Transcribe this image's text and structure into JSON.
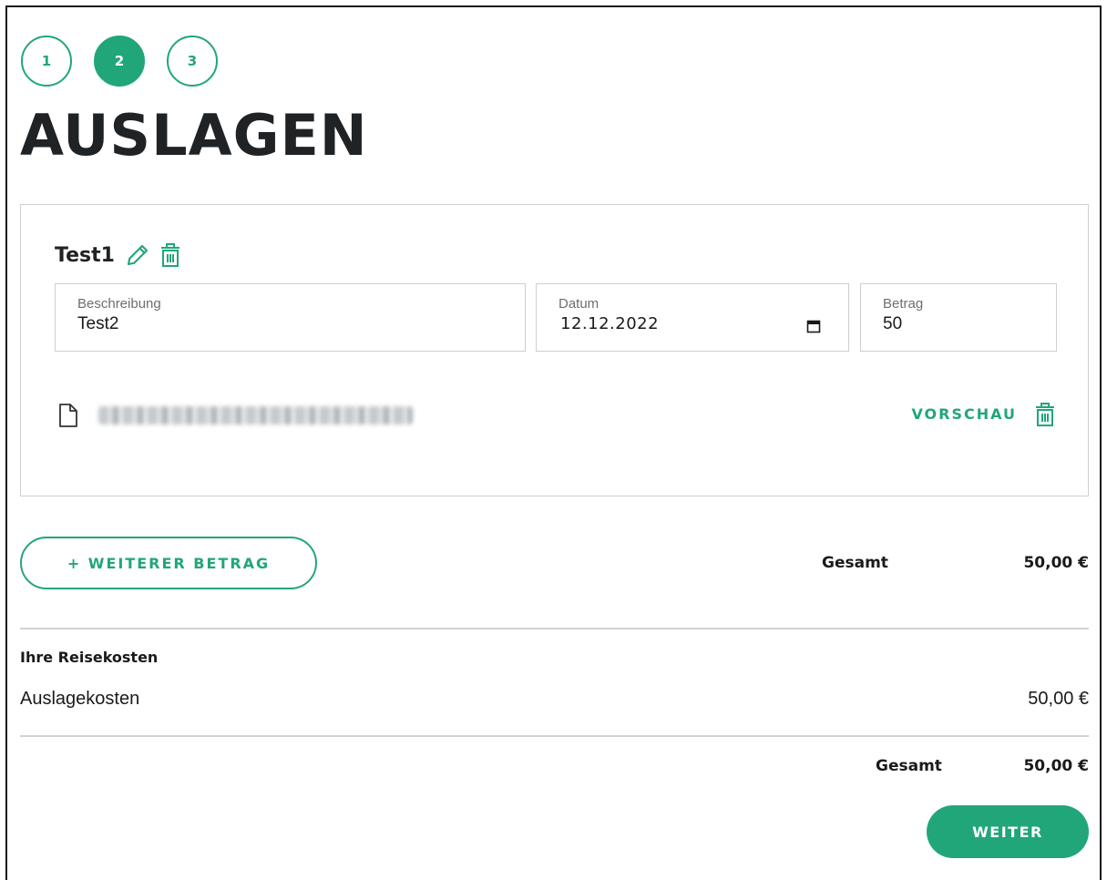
{
  "stepper": {
    "steps": [
      {
        "label": "1",
        "active": false
      },
      {
        "label": "2",
        "active": true
      },
      {
        "label": "3",
        "active": false
      }
    ]
  },
  "page": {
    "title": "AUSLAGEN"
  },
  "expense_item": {
    "title": "Test1",
    "edit_icon": "pencil-icon",
    "delete_icon": "trash-icon",
    "fields": {
      "description": {
        "label": "Beschreibung",
        "value": "Test2"
      },
      "date": {
        "label": "Datum",
        "value": "12.12.2022"
      },
      "amount": {
        "label": "Betrag",
        "value": "50"
      }
    },
    "attachment": {
      "icon": "document-icon",
      "preview_label": "VORSCHAU",
      "delete_icon": "trash-icon"
    }
  },
  "actions": {
    "add_amount_label": "+ WEITERER BETRAG"
  },
  "summary_top": {
    "total_label": "Gesamt",
    "total_value": "50,00 €"
  },
  "travel_costs": {
    "title": "Ihre Reisekosten",
    "lines": [
      {
        "label": "Auslagekosten",
        "value": "50,00 €"
      }
    ],
    "total_label": "Gesamt",
    "total_value": "50,00 €"
  },
  "footer": {
    "next_label": "WEITER"
  },
  "colors": {
    "accent": "#21a67a",
    "text": "#1f2326",
    "border": "#cfcfcf"
  }
}
